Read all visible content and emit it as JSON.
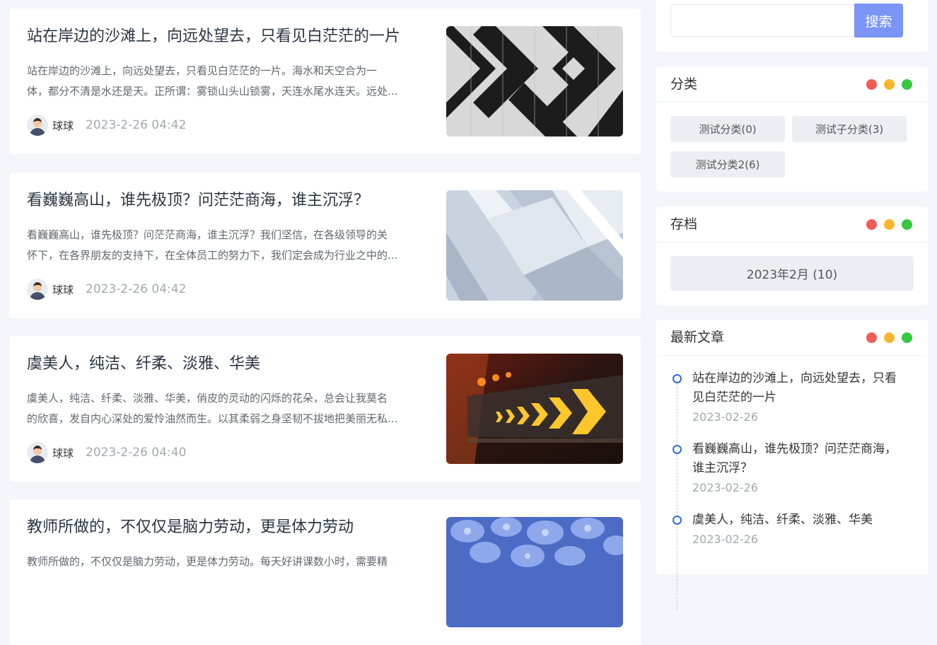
{
  "posts": [
    {
      "title": "站在岸边的沙滩上，向远处望去，只看见白茫茫的一片",
      "excerpt_lines": [
        "站在岸边的沙滩上，向远处望去，只看见白茫茫的一片。海水和天空合为一",
        "体，都分不清是水还是天。正所谓：雾锁山头山锁雾，天连水尾水连天。远处..."
      ],
      "author": "球球",
      "date": "2023-2-26 04:42",
      "thumb": "black-white-chevron-pattern"
    },
    {
      "title": "看巍巍高山，谁先极顶？问茫茫商海，谁主沉浮？",
      "excerpt_lines": [
        "看巍巍高山，谁先极顶？问茫茫商海，谁主沉浮？我们坚信，在各级领导的关",
        "怀下，在各界朋友的支持下，在全体员工的努力下，我们定会成为行业之中的..."
      ],
      "author": "球球",
      "date": "2023-2-26 04:42",
      "thumb": "white-architecture-geometry"
    },
    {
      "title": "虞美人，纯洁、纤柔、淡雅、华美",
      "excerpt_lines": [
        "虞美人，纯洁、纤柔、淡雅、华美，俏皮的灵动的闪烁的花朵，总会让我莫名",
        "的欣喜，发自内心深处的爱怜油然而生。以其柔弱之身坚韧不拔地把美丽无私..."
      ],
      "author": "球球",
      "date": "2023-2-26 04:40",
      "thumb": "led-arrow-signs"
    },
    {
      "title": "教师所做的，不仅仅是脑力劳动，更是体力劳动",
      "excerpt_lines": [
        "教师所做的，不仅仅是脑力劳动，更是体力劳动。每天好讲课数小时，需要精",
        ""
      ],
      "author": "",
      "date": "",
      "thumb": "blue-hydrangea-flowers"
    }
  ],
  "sidebar": {
    "search": {
      "placeholder": "",
      "button_label": "搜索"
    },
    "categories": {
      "title": "分类",
      "items": [
        "测试分类(0)",
        "测试子分类(3)",
        "测试分类2(6)"
      ]
    },
    "archive": {
      "title": "存档",
      "items": [
        "2023年2月 (10)"
      ]
    },
    "latest": {
      "title": "最新文章",
      "items": [
        {
          "title": "站在岸边的沙滩上，向远处望去，只看见白茫茫的一片",
          "date": "2023-02-26"
        },
        {
          "title": "看巍巍高山，谁先极顶？问茫茫商海，谁主沉浮？",
          "date": "2023-02-26"
        },
        {
          "title": "虞美人，纯洁、纤柔、淡雅、华美",
          "date": "2023-02-26"
        }
      ]
    },
    "window_dot_colors": [
      "#f05b57",
      "#f9b62e",
      "#36c840"
    ]
  },
  "colors": {
    "accent": "#7b95f7",
    "timeline_dot": "#2f6fd8",
    "page_bg": "#f3f5fb"
  }
}
